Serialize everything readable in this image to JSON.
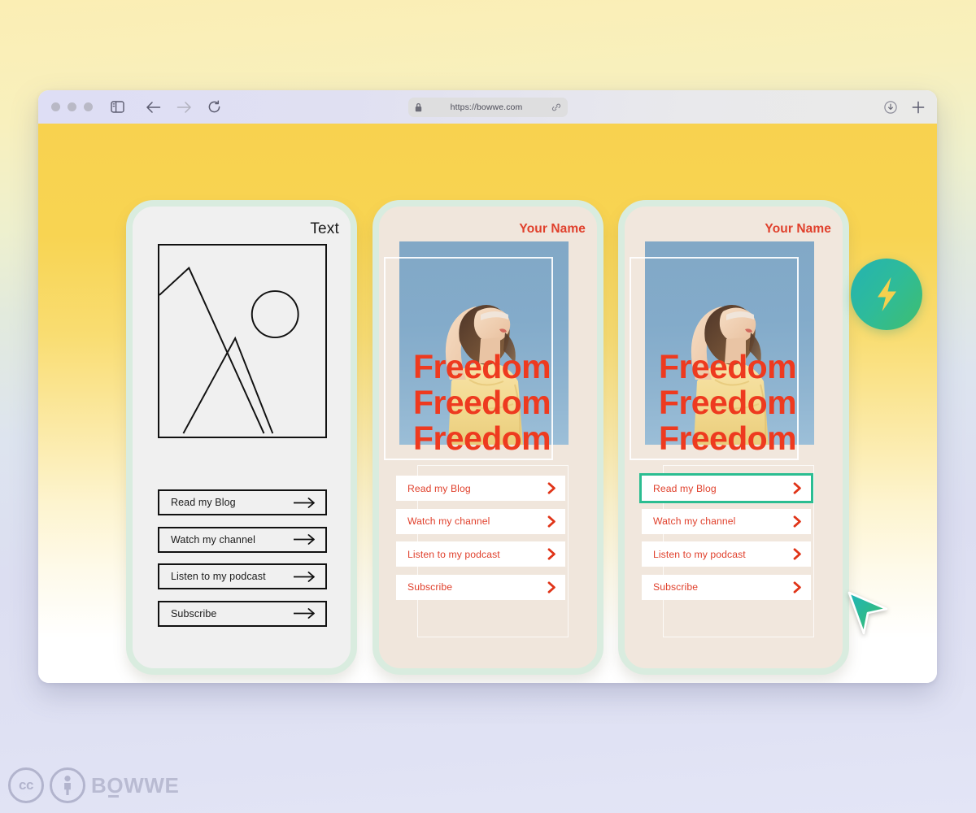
{
  "browser": {
    "traffic_lights": [
      "close",
      "minimize",
      "maximize"
    ],
    "sidebar_icon": "sidebar-toggle-icon",
    "back_icon": "arrow-left-icon",
    "forward_icon": "arrow-right-icon",
    "reload_icon": "reload-icon",
    "download_icon": "download-icon",
    "new_tab_icon": "plus-icon",
    "url": "https://bowwe.com",
    "lock_icon": "lock-icon",
    "link_icon": "link-icon"
  },
  "badge": {
    "icon": "lightning-bolt-icon",
    "gradient_from": "#24b3b2",
    "gradient_to": "#3fbe6f",
    "bolt_color": "#f5d04e"
  },
  "cursor": {
    "icon": "cursor-arrow-icon",
    "gradient_from": "#1fb5ba",
    "gradient_to": "#3cbe63"
  },
  "cards": [
    {
      "id": "wireframe-card",
      "title": "Text",
      "style": "wireframe",
      "background": "#f0f0f0",
      "border_color": "#d9ecdf",
      "image_placeholder": "mountain-sun-placeholder-icon",
      "buttons": [
        {
          "label": "Read my Blog",
          "icon": "arrow-right-icon",
          "selected": false
        },
        {
          "label": "Watch my channel",
          "icon": "arrow-right-icon",
          "selected": false
        },
        {
          "label": "Listen to my podcast",
          "icon": "arrow-right-icon",
          "selected": false
        },
        {
          "label": "Subscribe",
          "icon": "arrow-right-icon",
          "selected": false
        }
      ]
    },
    {
      "id": "template-card-a",
      "title": "Your Name",
      "style": "photo",
      "background": "#f0e6dc",
      "border_color": "#d9ecdf",
      "title_color": "#e0402c",
      "headline_color": "#ee3a1f",
      "headline_lines": [
        "Freedom",
        "Freedom",
        "Freedom"
      ],
      "photo_alt": "woman-looking-up-sky-photo",
      "buttons": [
        {
          "label": "Read my Blog",
          "icon": "chevron-right-icon",
          "selected": false
        },
        {
          "label": "Watch my channel",
          "icon": "chevron-right-icon",
          "selected": false
        },
        {
          "label": "Listen to my podcast",
          "icon": "chevron-right-icon",
          "selected": false
        },
        {
          "label": "Subscribe",
          "icon": "chevron-right-icon",
          "selected": false
        }
      ]
    },
    {
      "id": "template-card-b",
      "title": "Your Name",
      "style": "photo",
      "background": "#f1e7dd",
      "border_color": "#d9ecdf",
      "title_color": "#e0402c",
      "headline_color": "#ee3a1f",
      "headline_lines": [
        "Freedom",
        "Freedom",
        "Freedom"
      ],
      "photo_alt": "woman-looking-up-sky-photo",
      "selection_color": "#2bbd91",
      "buttons": [
        {
          "label": "Read my Blog",
          "icon": "chevron-right-icon",
          "selected": true
        },
        {
          "label": "Watch my channel",
          "icon": "chevron-right-icon",
          "selected": false
        },
        {
          "label": "Listen to my podcast",
          "icon": "chevron-right-icon",
          "selected": false
        },
        {
          "label": "Subscribe",
          "icon": "chevron-right-icon",
          "selected": false
        }
      ]
    }
  ],
  "watermark": {
    "cc_label": "cc",
    "by_icon": "cc-by-person-icon",
    "brand": "BOWWE"
  }
}
